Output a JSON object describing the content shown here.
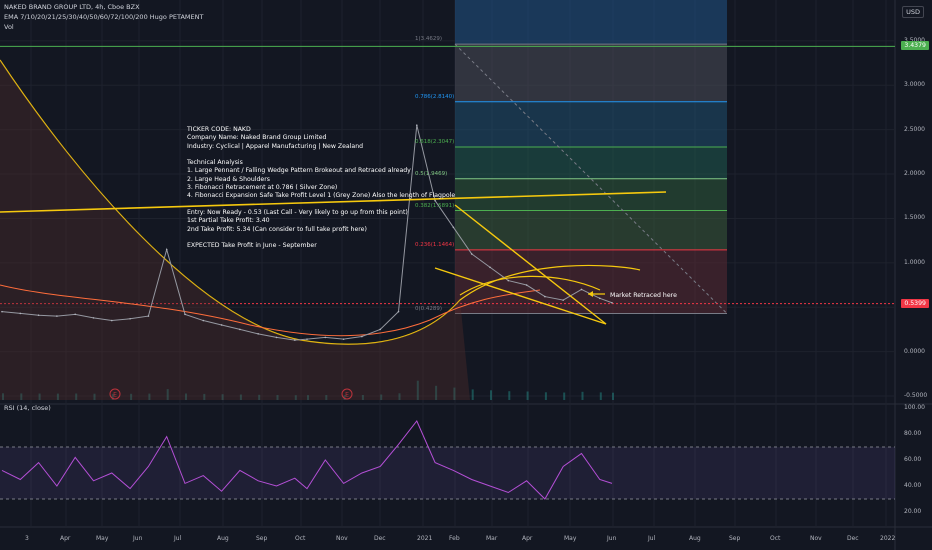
{
  "header": {
    "title": "NAKED BRAND GROUP LTD, 4h, Cboe BZX",
    "indicator": "EMA 7/10/20/21/25/30/40/50/60/72/100/200 Hugo PETAMENT",
    "volume": "Vol",
    "currency": "USD"
  },
  "rsi_label": "RSI (14, close)",
  "annotation": {
    "lines": [
      "TICKER CODE: NAKD",
      "Company Name: Naked Brand Group Limited",
      "Industry: Cyclical | Apparel Manufacturing | New Zealand",
      "",
      "Technical Analysis",
      "1. Large Pennant / Falling Wedge Pattern Brokeout and Retraced already",
      "2. Large Head & Shoulders",
      "3. Fibonacci Retracement at 0.786 ( Silver Zone)",
      "4. Fibonacci Expansion Safe Take Profit Level 1 (Grey Zone) Also the length of Flagpole",
      "",
      "Entry: Now Ready - 0.53 (Last Call - Very likely to go up from this point)",
      "1st Partial Take Profit: 3.40",
      "2nd Take Profit: 5.34 (Can consider to full take profit here)",
      "",
      "EXPECTED Take Profit in June - September"
    ],
    "market_note": "Market Retraced here"
  },
  "chart_data": [
    {
      "type": "line",
      "title": "NAKED BRAND GROUP LTD, 4h, Cboe BZX",
      "x_ticks": [
        "3",
        "Apr",
        "May",
        "Jun",
        "Jul",
        "Aug",
        "Sep",
        "Oct",
        "Nov",
        "Dec",
        "2021",
        "Feb",
        "Mar",
        "Apr",
        "May",
        "Jun",
        "Jul",
        "Aug",
        "Sep",
        "Oct",
        "Nov",
        "Dec",
        "2022"
      ],
      "y_ticks": [
        "-0.5000",
        "0.0000",
        "0.5000",
        "1.0000",
        "1.5000",
        "2.0000",
        "2.5000",
        "3.0000",
        "3.5000"
      ],
      "ylim": [
        -0.5,
        3.6
      ],
      "price_labels": [
        {
          "text": "3.4379",
          "value": 3.4379,
          "color": "#4caf50"
        },
        {
          "text": "0.5399",
          "value": 0.5399,
          "color": "#f23645"
        }
      ],
      "fibonacci": [
        {
          "level": "1",
          "text": "1(3.4629)",
          "value": 3.4629,
          "color": "#787b86"
        },
        {
          "level": "0.786",
          "text": "0.786(2.8140)",
          "value": 2.814,
          "color": "#2196f3"
        },
        {
          "level": "0.618",
          "text": "0.618(2.3047)",
          "value": 2.3047,
          "color": "#4caf50"
        },
        {
          "level": "0.5",
          "text": "0.5(1.9469)",
          "value": 1.9469,
          "color": "#81c784"
        },
        {
          "level": "0.382",
          "text": "0.382(1.5891)",
          "value": 1.5891,
          "color": "#4caf50"
        },
        {
          "level": "0.236",
          "text": "0.236(1.1464)",
          "value": 1.1464,
          "color": "#f23645"
        },
        {
          "level": "0",
          "text": "0(0.4289)",
          "value": 0.4289,
          "color": "#787b86"
        }
      ],
      "event_markers": [
        "E",
        "E"
      ],
      "series": [
        {
          "x": [
            0,
            6,
            12,
            18,
            24,
            30,
            36,
            42,
            48,
            54,
            60,
            66,
            72,
            78,
            84,
            90,
            96,
            100,
            106,
            112,
            118,
            124,
            130,
            136,
            142,
            148,
            154,
            160,
            166,
            172,
            178,
            184,
            190,
            196,
            200
          ],
          "values": [
            0.45,
            0.43,
            0.41,
            0.4,
            0.42,
            0.38,
            0.35,
            0.37,
            0.4,
            1.15,
            0.42,
            0.35,
            0.3,
            0.25,
            0.2,
            0.16,
            0.13,
            0.14,
            0.16,
            0.14,
            0.17,
            0.25,
            0.45,
            2.55,
            1.7,
            1.4,
            1.1,
            0.95,
            0.8,
            0.75,
            0.62,
            0.58,
            0.7,
            0.6,
            0.55
          ]
        }
      ]
    },
    {
      "type": "line",
      "title": "RSI (14, close)",
      "y_ticks": [
        "20.00",
        "40.00",
        "60.00",
        "80.00",
        "100.00"
      ],
      "ylim": [
        10,
        100
      ],
      "bands": [
        70,
        30
      ],
      "series": [
        {
          "x": [
            0,
            6,
            12,
            18,
            24,
            30,
            36,
            42,
            48,
            54,
            60,
            66,
            72,
            78,
            84,
            90,
            96,
            100,
            106,
            112,
            118,
            124,
            130,
            136,
            142,
            148,
            154,
            160,
            166,
            172,
            178,
            184,
            190,
            196,
            200
          ],
          "values": [
            52,
            45,
            58,
            40,
            62,
            44,
            50,
            38,
            55,
            78,
            42,
            48,
            36,
            52,
            44,
            40,
            46,
            38,
            60,
            42,
            50,
            55,
            72,
            90,
            58,
            52,
            45,
            40,
            35,
            44,
            30,
            55,
            65,
            45,
            42
          ]
        }
      ]
    }
  ]
}
